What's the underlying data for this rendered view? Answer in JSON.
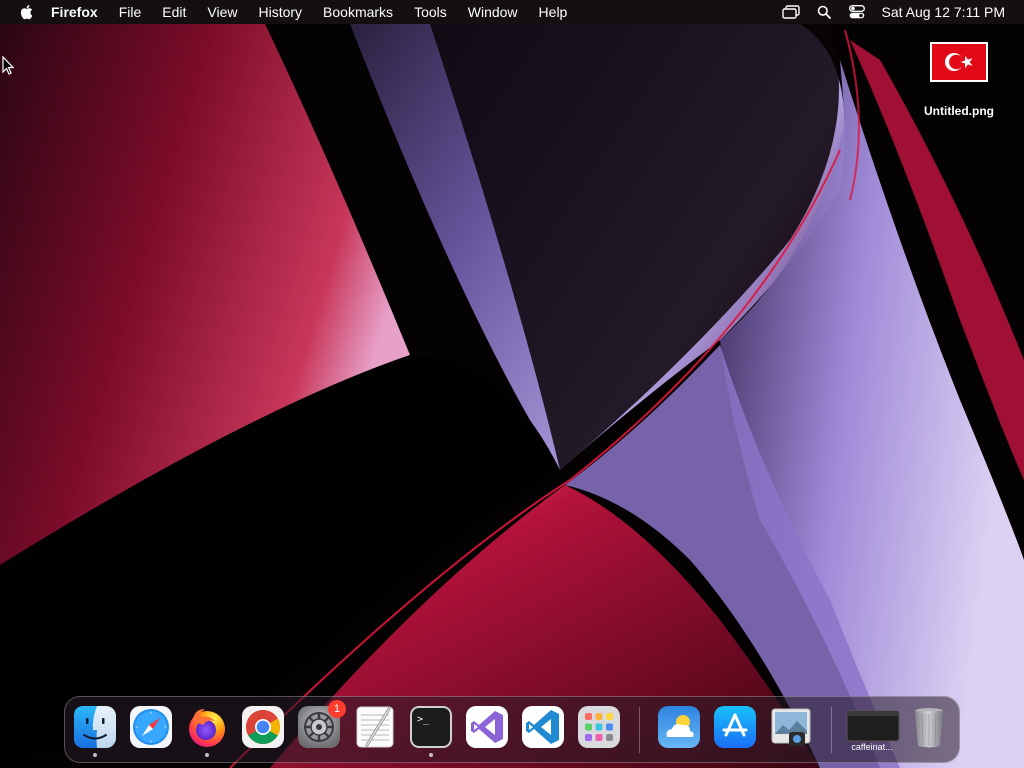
{
  "menubar": {
    "apple_icon": "apple-logo-icon",
    "app_name": "Firefox",
    "items": [
      "File",
      "Edit",
      "View",
      "History",
      "Bookmarks",
      "Tools",
      "Window",
      "Help"
    ],
    "status_icons": [
      "screen-mirroring-icon",
      "spotlight-search-icon",
      "control-center-icon"
    ],
    "clock": "Sat Aug 12  7:11 PM"
  },
  "desktop_files": [
    {
      "name": "Untitled.png",
      "thumbnail": "turkish-flag"
    }
  ],
  "dock": {
    "apps": [
      {
        "name": "Finder",
        "icon": "finder-icon",
        "running": true
      },
      {
        "name": "Safari",
        "icon": "safari-icon",
        "running": false
      },
      {
        "name": "Firefox",
        "icon": "firefox-icon",
        "running": true
      },
      {
        "name": "Google Chrome",
        "icon": "chrome-icon",
        "running": false
      },
      {
        "name": "System Settings",
        "icon": "system-settings-icon",
        "running": false,
        "badge": "1"
      },
      {
        "name": "TextEdit",
        "icon": "textedit-icon",
        "running": false
      },
      {
        "name": "Terminal",
        "icon": "terminal-icon",
        "running": true
      },
      {
        "name": "Visual Studio",
        "icon": "visual-studio-icon",
        "running": false
      },
      {
        "name": "Visual Studio Code",
        "icon": "vscode-icon",
        "running": false
      },
      {
        "name": "Launchpad",
        "icon": "launchpad-icon",
        "running": false
      },
      {
        "name": "Weather",
        "icon": "weather-icon",
        "running": false
      },
      {
        "name": "App Store",
        "icon": "app-store-icon",
        "running": false
      },
      {
        "name": "Preview",
        "icon": "preview-icon",
        "running": false
      }
    ],
    "minimized": [
      {
        "label": "caffeinat...",
        "icon": "terminal-window-thumbnail"
      }
    ],
    "trash": {
      "name": "Trash",
      "icon": "trash-icon"
    }
  },
  "colors": {
    "wallpaper_red": "#b3123a",
    "wallpaper_purple": "#9c86d8",
    "badge_red": "#ff3b30",
    "flag_red": "#e30a17"
  }
}
